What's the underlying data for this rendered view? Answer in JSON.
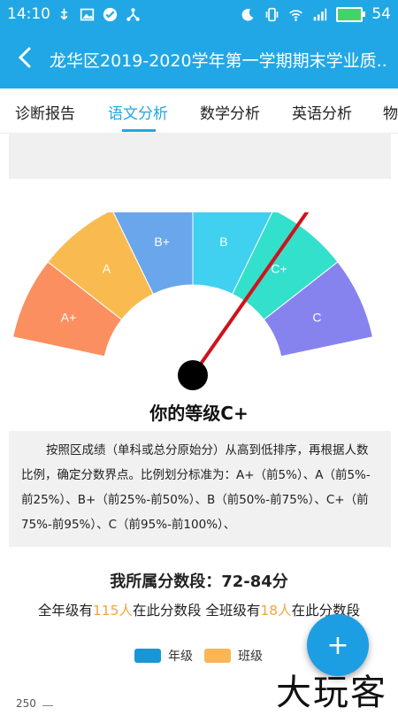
{
  "statusbar": {
    "time": "14:10",
    "battery": "54",
    "icons": [
      "usb-icon",
      "image-icon",
      "check-circle-icon",
      "share-icon",
      "moon-icon",
      "vibrate-icon",
      "wifi-icon",
      "signal-icon",
      "battery-icon"
    ]
  },
  "appbar": {
    "title": "龙华区2019-2020学年第一学期期末学业质.."
  },
  "tabs": [
    {
      "label": "诊断报告",
      "active": false
    },
    {
      "label": "语文分析",
      "active": true
    },
    {
      "label": "数学分析",
      "active": false
    },
    {
      "label": "英语分析",
      "active": false
    },
    {
      "label": "物",
      "active": false
    }
  ],
  "gauge": {
    "segments": [
      {
        "label": "A+",
        "color": "#fb8f5f"
      },
      {
        "label": "A",
        "color": "#f9bb4f"
      },
      {
        "label": "B+",
        "color": "#6aa6ec"
      },
      {
        "label": "B",
        "color": "#3fd1ef"
      },
      {
        "label": "C+",
        "color": "#33e0cc"
      },
      {
        "label": "C",
        "color": "#8683ef"
      }
    ],
    "pointer_value": "C+",
    "needle_color": "#d0121b"
  },
  "grade_text": "你的等级C+",
  "explanation": "按照区成绩（单科或总分原始分）从高到低排序，再根据人数比例，确定分数界点。比例划分标准为：A+（前5%）、A（前5%-前25%）、B+（前25%-前50%）、B（前50%-前75%）、C+（前75%-前95%）、C（前95%-前100%）、",
  "segment_title": "我所属分数段：72-84分",
  "counts": {
    "prefix": "全年级有",
    "grade_count": "115人",
    "mid": "在此分数段 全班级有",
    "class_count": "18人",
    "suffix": "在此分数段"
  },
  "legend": [
    {
      "label": "年级",
      "color": "#1a96d4"
    },
    {
      "label": "班级",
      "color": "#f9b655"
    }
  ],
  "chart_axis_label": "250",
  "fab_label": "+",
  "watermark": "大玩客"
}
